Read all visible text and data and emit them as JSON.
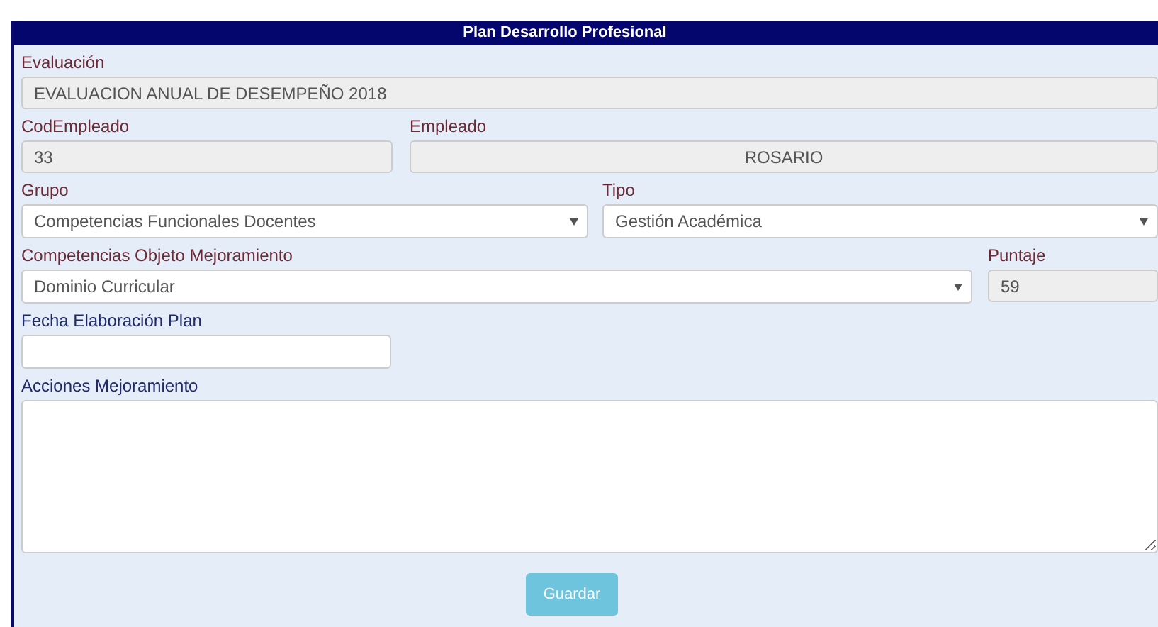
{
  "panel": {
    "title": "Plan Desarrollo Profesional"
  },
  "rows": [
    {
      "fields": [
        {
          "label": "Evaluación",
          "color": "#6b2a35",
          "kind": "readonly",
          "value": "EVALUACION ANUAL DE DESEMPEÑO 2018"
        }
      ]
    },
    {
      "fields": [
        {
          "label": "CodEmpleado",
          "color": "#6b2a35",
          "kind": "readonly",
          "value": "33"
        },
        {
          "label": "Empleado",
          "color": "#6b2a35",
          "kind": "readonly_center",
          "value": "ROSARIO"
        }
      ]
    },
    {
      "fields": [
        {
          "label": "Grupo",
          "color": "#6b2a35",
          "kind": "select",
          "value": "Competencias Funcionales Docentes"
        },
        {
          "label": "Tipo",
          "color": "#6b2a35",
          "kind": "select",
          "value": "Gestión Académica"
        }
      ]
    },
    {
      "fields": [
        {
          "label": "Competencias Objeto Mejoramiento",
          "color": "#6b2a35",
          "kind": "select",
          "value": "Dominio Curricular"
        },
        {
          "label": "Puntaje",
          "color": "#6b2a35",
          "kind": "readonly",
          "value": "59"
        }
      ]
    },
    {
      "fields": [
        {
          "label": "Fecha Elaboración Plan",
          "color": "#1f2a6b",
          "kind": "input"
        }
      ]
    },
    {
      "fields": [
        {
          "label": "Acciones Mejoramiento",
          "color": "#1f2a6b",
          "kind": "textarea"
        }
      ]
    }
  ],
  "buttons": [
    "Guardar"
  ]
}
